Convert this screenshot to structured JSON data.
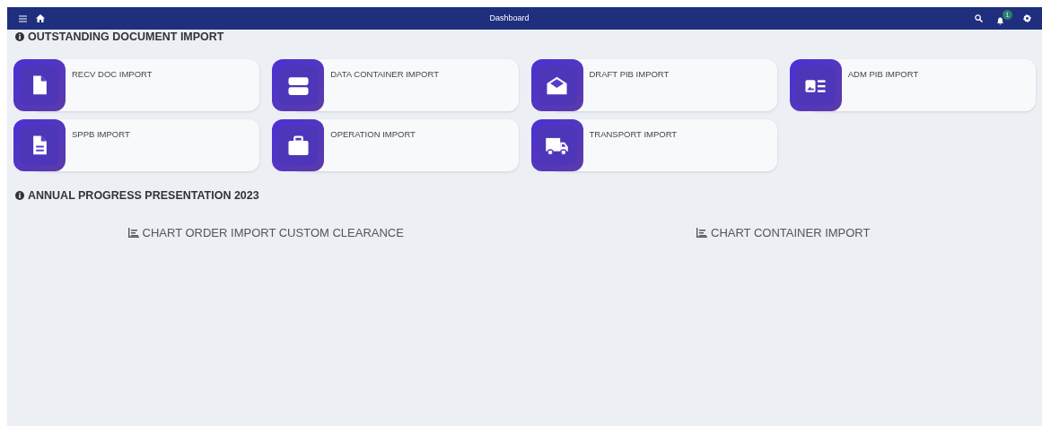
{
  "header": {
    "title": "Dashboard",
    "notification_count": "1"
  },
  "sections": [
    {
      "title": "OUTSTANDING DOCUMENT IMPORT"
    },
    {
      "title": "ANNUAL PROGRESS PRESENTATION 2023"
    }
  ],
  "cards": [
    {
      "label": "RECV DOC IMPORT",
      "kind": "file"
    },
    {
      "label": "DATA CONTAINER IMPORT",
      "kind": "stack"
    },
    {
      "label": "DRAFT PIB IMPORT",
      "kind": "envelope"
    },
    {
      "label": "ADM PIB IMPORT",
      "kind": "idcard"
    },
    {
      "label": "SPPB IMPORT",
      "kind": "filetext"
    },
    {
      "label": "OPERATION IMPORT",
      "kind": "briefcase"
    },
    {
      "label": "TRANSPORT IMPORT",
      "kind": "truck"
    }
  ],
  "charts": [
    {
      "title": "CHART ORDER IMPORT CUSTOM CLEARANCE"
    },
    {
      "title": "CHART CONTAINER IMPORT"
    }
  ]
}
